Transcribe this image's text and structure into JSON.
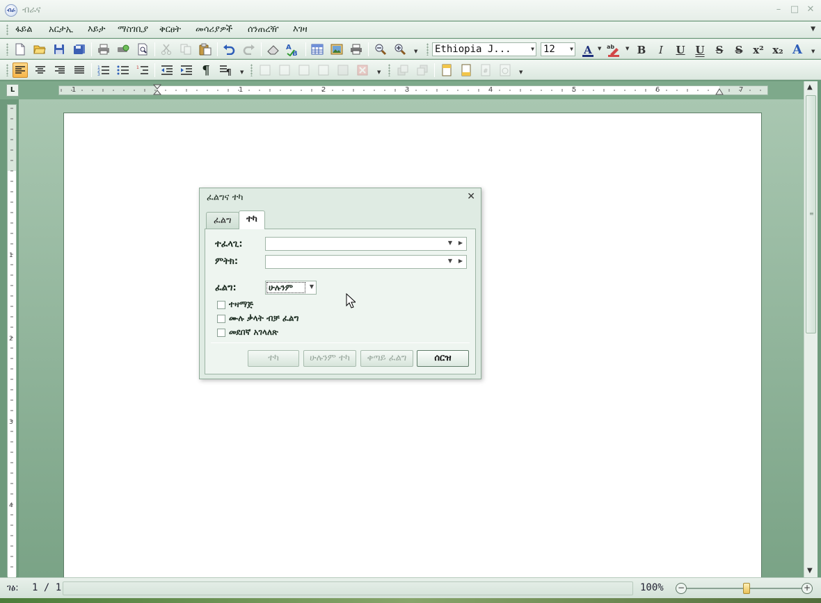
{
  "window": {
    "title": "ብራና",
    "app_icon": "ብራ"
  },
  "menu": [
    "ፋይል",
    "አርታኢ",
    "እይታ",
    "ማስገቢያ",
    "ቅርፀት",
    "መሳሪያዎች",
    "ሰንጠረዥ",
    "እገዛ"
  ],
  "toolbar": {
    "font_name": "Ethiopia J...",
    "font_size": "12",
    "superscript": "x²",
    "subscript": "x₂"
  },
  "ruler": {
    "h_numbers": [
      "1",
      "1",
      "2",
      "3",
      "4",
      "5",
      "6",
      "7"
    ],
    "v_numbers": [
      "1",
      "2",
      "3",
      "4"
    ]
  },
  "dialog": {
    "title": "ፈልግና ተካ",
    "tabs": [
      "ፈልግ",
      "ተካ"
    ],
    "active_tab": "ተካ",
    "find_label": "ተፈላጊ:",
    "replace_label": "ምትክ:",
    "find_value": "",
    "replace_value": "",
    "search_label": "ፈልግ:",
    "search_value": "ሁሉንም",
    "options": [
      "ተዛማጅ",
      "ሙሉ ቃላት ብቻ ፈልግ",
      "መደበኛ አገላለጽ"
    ],
    "buttons": {
      "replace": "ተካ",
      "replace_all": "ሁሉንም ተካ",
      "find_next": "ቀጣይ ፈልግ",
      "cancel": "ሰርዝ"
    }
  },
  "status": {
    "page_label": "ገፅ:",
    "page_value": "1 / 1",
    "zoom": "100%",
    "zoom_level_percent": 52
  },
  "colors": {
    "accent": "#f7b54a",
    "frame": "#6e9a7c",
    "page": "#ffffff"
  },
  "icons": [
    "new-document-icon",
    "open-folder-icon",
    "save-icon",
    "save-all-icon",
    "print-icon",
    "print-preview-icon",
    "find-icon",
    "cut-icon",
    "copy-icon",
    "paste-icon",
    "undo-icon",
    "redo-icon",
    "eraser-icon",
    "spellcheck-icon",
    "table-icon",
    "image-icon",
    "printer-icon",
    "zoom-out-icon",
    "zoom-in-icon"
  ]
}
